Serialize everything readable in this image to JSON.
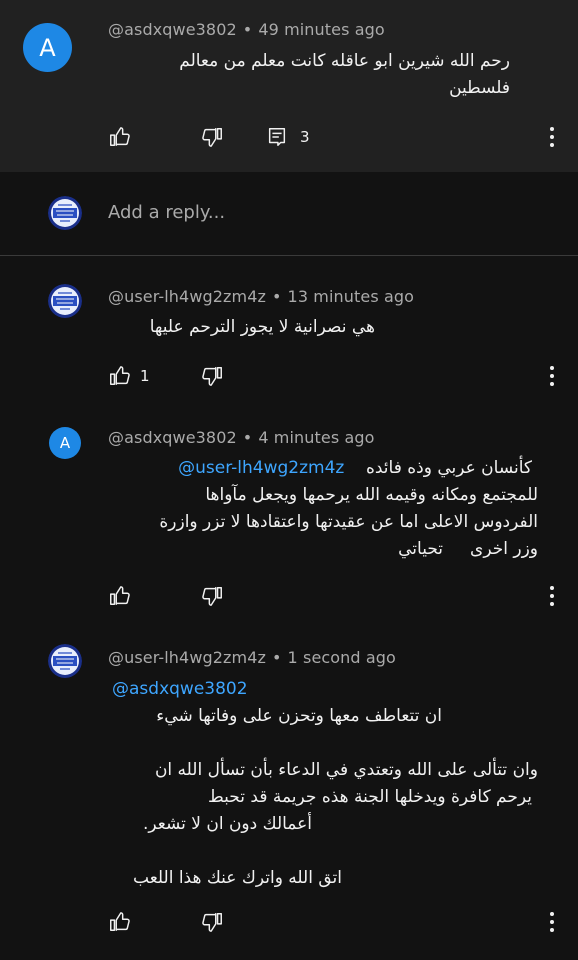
{
  "top_comment": {
    "avatar_letter": "A",
    "author": "@asdxqwe3802",
    "time": "49 minutes ago",
    "lines": [
      "رحم الله شيرين ابو عاقله كانت معلم من معالم",
      "فلسطين"
    ],
    "reply_count": "3"
  },
  "reply_box": {
    "placeholder": "Add a reply..."
  },
  "replies": [
    {
      "author": "@user-lh4wg2zm4z",
      "time": "13 minutes ago",
      "lines": [
        "هي نصرانية لا يجوز الترحم عليها"
      ],
      "like_count": "1"
    },
    {
      "avatar_letter": "A",
      "author": "@asdxqwe3802",
      "time": "4 minutes ago",
      "mention": "@user-lh4wg2zm4z",
      "first_line_text": "كأنسان عربي وذه فائده",
      "lines": [
        "للمجتمع ومكانه وقيمه الله يرحمها ويجعل مآواها",
        "الفردوس الاعلى اما عن عقيدتها واعتقادها لا تزر وازرة",
        "وزر اخرى     تحياتي"
      ]
    },
    {
      "author": "@user-lh4wg2zm4z",
      "time": "1 second ago",
      "mention": "@asdxqwe3802",
      "lines": [
        "ان تتعاطف معها وتحزن على وفاتها شيء",
        "",
        "وان تتألى على الله وتعتدي في الدعاء بأن تسأل الله ان",
        "يرحم كافرة ويدخلها الجنة هذه جريمة قد تحبط",
        "أعمالك دون ان لا تشعر.",
        "",
        "اتق الله واترك عنك هذا اللعب"
      ]
    }
  ],
  "colors": {
    "accent": "#3ea6ff",
    "avatar_blue": "#1e88e5",
    "top_bg": "#212121",
    "bg": "#121212"
  }
}
